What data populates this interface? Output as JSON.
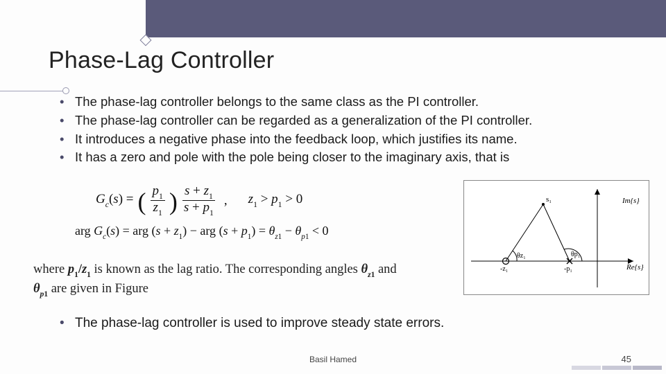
{
  "title": "Phase-Lag Controller",
  "bullets": [
    "The phase-lag controller belongs to the same class as the PI controller.",
    "The phase-lag controller can be regarded as a generalization of the PI controller.",
    " It introduces a negative phase into the feedback loop, which justifies its name.",
    "It has a zero and pole with the pole being closer to the imaginary axis, that is"
  ],
  "formula": {
    "text_chunks": {
      "Gc": "G",
      "c": "c",
      "s_open": "(",
      "s_var": "s",
      "s_close": ") = ",
      "p1": "p",
      "z1": "z",
      "one": "1",
      "plus": " + ",
      "comma": ",",
      "cond": "z",
      "gt": " > ",
      "zero": "0",
      "arg": "arg ",
      "minus": " − ",
      "eq": " = ",
      "theta": "θ",
      "lt": " < 0"
    }
  },
  "where": {
    "prefix": "where ",
    "ratio_p": "p",
    "ratio_slash": "/",
    "ratio_z": "z",
    "one": "1",
    "mid": " is known as the lag ratio. The corresponding angles ",
    "theta": "θ",
    "zsub": "z",
    "and_newline": " and",
    "psub": "p",
    "tail": " are given in Figure"
  },
  "diagram": {
    "axis_im": "Im{s}",
    "axis_re": "Re{s}",
    "s1": "s₁",
    "theta_z": "θz₁",
    "theta_p": "θp₁",
    "minus_z": "-z₁",
    "minus_p": "-p₁"
  },
  "last_bullet": "The phase-lag controller is used to improve steady state errors.",
  "footer": {
    "author": "Basil Hamed",
    "page": "45"
  }
}
